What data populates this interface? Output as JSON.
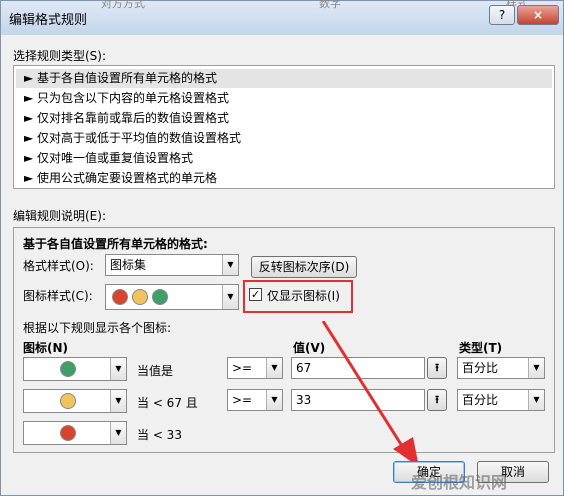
{
  "window": {
    "title": "编辑格式规则",
    "help": "?",
    "close": "×",
    "bg_left": "对方方式",
    "bg_mid": "数字",
    "bg_right": "样式"
  },
  "rule_type": {
    "label": "选择规则类型(S):",
    "items": [
      "► 基于各自值设置所有单元格的格式",
      "► 只为包含以下内容的单元格设置格式",
      "► 仅对排名靠前或靠后的数值设置格式",
      "► 仅对高于或低于平均值的数值设置格式",
      "► 仅对唯一值或重复值设置格式",
      "► 使用公式确定要设置格式的单元格"
    ]
  },
  "rule_desc": {
    "label": "编辑规则说明(E):",
    "heading": "基于各自值设置所有单元格的格式:",
    "format_style_label": "格式样式(O):",
    "format_style_value": "图标集",
    "reverse_button": "反转图标次序(D)",
    "icon_style_label": "图标样式(C):",
    "show_icon_only_label": "仅显示图标(I)",
    "show_icon_only_checked": true,
    "rules_intro": "根据以下规则显示各个图标:",
    "col_icon": "图标(N)",
    "col_value": "值(V)",
    "col_type": "类型(T)",
    "rows": [
      {
        "icon_color": "#3f9e6a",
        "cond": "当值是",
        "op": ">=",
        "value": "67",
        "type": "百分比"
      },
      {
        "icon_color": "#f0c35c",
        "cond": "当 < 67 且",
        "op": ">=",
        "value": "33",
        "type": "百分比"
      },
      {
        "icon_color": "#d9442c",
        "cond": "当 < 33",
        "op": "",
        "value": "",
        "type": ""
      }
    ]
  },
  "icon_style_colors": [
    "#d9442c",
    "#f0c35c",
    "#3f9e6a"
  ],
  "footer": {
    "ok": "确定",
    "cancel": "取消"
  },
  "watermark": "爱创根知识网",
  "highlight_color": "#e03030"
}
